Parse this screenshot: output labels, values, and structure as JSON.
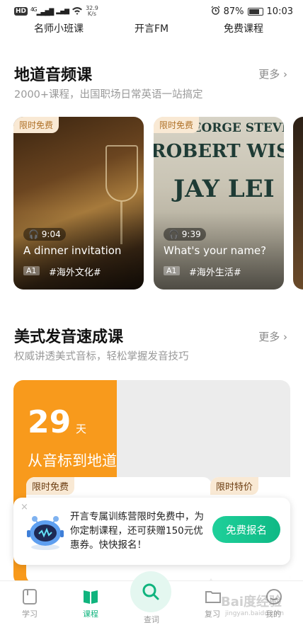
{
  "status_bar": {
    "network": "4G",
    "speed": "32.9",
    "speed_unit": "K/s",
    "battery": "87%",
    "time": "10:03"
  },
  "top_nav": [
    "名师小班课",
    "开言FM",
    "免费课程"
  ],
  "audio_section": {
    "title": "地道音频课",
    "more": "更多",
    "subtitle": "2000+课程，出国职场日常英语一站搞定",
    "cards": [
      {
        "badge": "限时免费",
        "duration": "9:04",
        "title": "A dinner invitation",
        "level": "A1",
        "tag": "#海外文化#"
      },
      {
        "badge": "限时免费",
        "duration": "9:39",
        "title": "What's your name?",
        "level": "A1",
        "tag": "#海外生活#",
        "sign_lines": [
          "GEORGE STEVE",
          "ROBERT WIS",
          "JAY LEI"
        ]
      }
    ]
  },
  "pron_section": {
    "title": "美式发音速成课",
    "more": "更多",
    "subtitle": "权威讲透美式音标，轻松掌握发音技巧",
    "promo": {
      "number": "29",
      "unit": "天",
      "slogan": "从音标到地道",
      "card_badges": [
        "限时免费",
        "限时特价"
      ]
    }
  },
  "popup": {
    "close": "×",
    "message": "开言专属训练营限时免费中，为你定制课程，还可获赠150元优惠券。快快报名！",
    "button": "免费报名"
  },
  "tabbar": [
    "学习",
    "课程",
    "查词",
    "复习",
    "我的"
  ],
  "watermark": {
    "text": "Bai度经验",
    "url": "jingyan.baidu.com"
  },
  "colors": {
    "accent": "#10b47e",
    "promo_orange": "#f89a1c",
    "badge_bg": "#f9e9d4"
  }
}
